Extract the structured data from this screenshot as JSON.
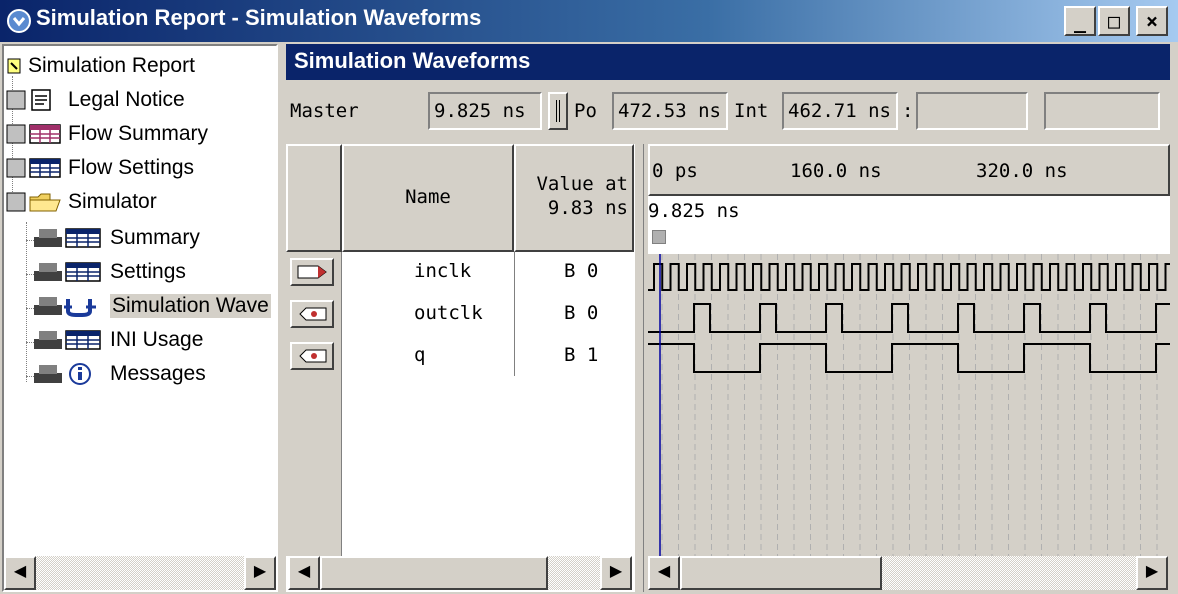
{
  "window": {
    "title": "Simulation Report - Simulation Waveforms",
    "controls": {
      "minimize": "_",
      "maximize": "□",
      "close": "×"
    }
  },
  "tree": {
    "root": {
      "label": "Simulation Report",
      "icon": "report-icon"
    },
    "items": [
      {
        "label": "Legal Notice",
        "icon": "document-icon"
      },
      {
        "label": "Flow Summary",
        "icon": "table-icon"
      },
      {
        "label": "Flow Settings",
        "icon": "table-icon"
      },
      {
        "label": "Simulator",
        "icon": "folder-icon"
      }
    ],
    "children": [
      {
        "label": "Summary",
        "icon": "table-icon"
      },
      {
        "label": "Settings",
        "icon": "table-icon"
      },
      {
        "label": "Simulation Wave",
        "icon": "waveform-icon",
        "selected": true
      },
      {
        "label": "INI Usage",
        "icon": "table-icon"
      },
      {
        "label": "Messages",
        "icon": "info-icon"
      }
    ]
  },
  "pane": {
    "title": "Simulation Waveforms",
    "master_label": "Master",
    "master_value": "9.825 ns",
    "pointer_label": "Po",
    "pointer_value": "472.53 ns",
    "interval_label": "Int",
    "interval_value": "462.71 ns",
    "interval_suffix": ":",
    "start_value": "",
    "end_value": ""
  },
  "columns": {
    "name": "Name",
    "value_line1": "Value at",
    "value_line2": "9.83 ns"
  },
  "timeline": {
    "ticks": [
      "0 ps",
      "160.0 ns",
      "320.0 ns"
    ],
    "cursor_label": "9.825 ns"
  },
  "signals": [
    {
      "name": "inclk",
      "value": "B 0",
      "type": "input"
    },
    {
      "name": "outclk",
      "value": "B 0",
      "type": "output"
    },
    {
      "name": "q",
      "value": "B 1",
      "type": "output"
    }
  ],
  "colors": {
    "title_bar": "#0a246a",
    "cursor": "#0000a0",
    "waveform": "#000000"
  }
}
